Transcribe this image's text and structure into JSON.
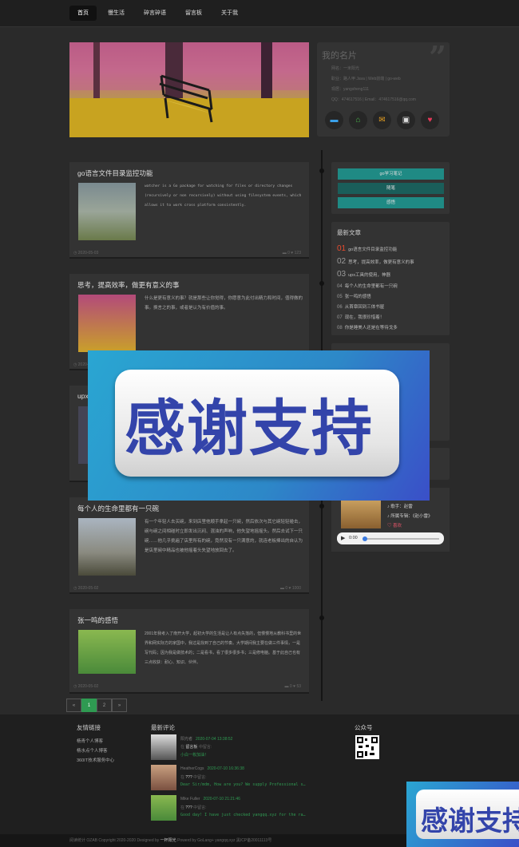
{
  "nav": {
    "items": [
      "首页",
      "慢生活",
      "碎言碎语",
      "留言板",
      "关于我"
    ],
    "active": 0
  },
  "card": {
    "title": "我的名片",
    "lines": [
      "网名：一米阳光",
      "职业：路人甲 Java | Web前端 | go-web",
      "现居：yangsheng111",
      "QQ：474617516 | Email：474617516@qq.com"
    ],
    "icons": [
      "chat-icon",
      "home-icon",
      "mail-icon",
      "image-icon",
      "heart-icon"
    ]
  },
  "posts": [
    {
      "title": "go语言文件目录监控功能",
      "summary": "watcher is a Go package for watching for files or directory changes (recursively or non recursively) without using filesystem events, which allows it to work cross platform consistently.",
      "date": "2020-05-03",
      "comments": "0",
      "likes": "123"
    },
    {
      "title": "思考，提高效率，做更有意义的事",
      "summary": "什么是更有意义的事？就是那些让你觉得，你愿意为此付出精力和时间，值得做的事。换言之的事，或者是认为有价值的事。",
      "date": "2020-05-02",
      "comments": "",
      "likes": ""
    },
    {
      "title": "upx",
      "summary": "",
      "date": "",
      "comments": "",
      "likes": ""
    },
    {
      "title": "每个人的生命里都有一只碗",
      "summary": "有一个年轻人去买碗，来到店里他顺手拿起一只碗，然后依次与其它碗轻轻碰击，碗与碗之间相碰时立即发出沉闷、混浊的声响，他失望地摇摇头。然后去试下一只碗……他几乎挑遍了店里所有的碗，竟然没有一只满意的，就连老板捧出的自认为是店里碗中精品也被他摇着头失望地放回去了。",
      "date": "2020-05-02",
      "comments": "0",
      "likes": "1000"
    },
    {
      "title": "张一鸣的感悟",
      "summary": "2001年我考入了南开大学，起初大学的生活是让人有点失落的，但慢慢地从教科书里的世界和网实际方的家国中，我过是找到了自己的节奏。大学期间我主要在做三件事情，一是写代码；因为我是做技术的；二是看书，看了很多很多书；三是修电脑。基于此自己也有三点收获：耐心、知识、伙伴。",
      "date": "2020-05-02",
      "comments": "0",
      "likes": "53"
    }
  ],
  "menu": [
    "go学习笔记",
    "随笔",
    "感悟"
  ],
  "latest": {
    "title": "最新文章",
    "items": [
      {
        "n": "01",
        "t": "go语言文件目录监控功能"
      },
      {
        "n": "02",
        "t": "思考，提高效率，做更有意义的事"
      },
      {
        "n": "03",
        "t": "upx工具的使用，神器"
      },
      {
        "n": "04",
        "t": "每个人的生命里都有一只碗"
      },
      {
        "n": "05",
        "t": "张一鸣的感悟"
      },
      {
        "n": "06",
        "t": "从首章回到三体书屋"
      },
      {
        "n": "07",
        "t": "现在，我很珍惜着！"
      },
      {
        "n": "08",
        "t": "你是睡美人还是在等待戈多"
      }
    ]
  },
  "music": {
    "singer": "歌手：赵雷",
    "album": "所属专辑：《赵小雷》",
    "like": "喜欢",
    "time": "0:00"
  },
  "overlay_text": "感谢支持",
  "pager": [
    "«",
    "1",
    "2",
    "»"
  ],
  "footer": {
    "links_title": "友情链接",
    "links": [
      "杨青个人博客",
      "杨水点个人博客",
      "360IT技术服务中心"
    ],
    "comments_title": "最新评论",
    "comments": [
      {
        "name": "阳光者",
        "time": "2020-07-04 13:38:52",
        "label": "在",
        "where": "留言板",
        "tail": "中留言:",
        "body": "小白一枚加油！"
      },
      {
        "name": "HeatherCogs",
        "time": "2020-07-10 16:36:38",
        "label": "在",
        "where": "???",
        "tail": "中留言:",
        "body": "Dear Sir/mdm, How are you? We supply Professional s…"
      },
      {
        "name": "Mike Fuller",
        "time": "2020-07-10 21:21:46",
        "label": "在",
        "where": "???",
        "tail": "中留言:",
        "body": "Good day! I have just checked yangqq.xyz for the ra…"
      }
    ],
    "wechat_title": "公众号",
    "copyright_pre": "阅读统计 OZAB Copyright 2020-2020 Designed by ",
    "copyright_author": "一杯阳光",
    "copyright_post": " Powerd by GoLang+ yangqq.xyz 黑ICP备20011113号"
  }
}
